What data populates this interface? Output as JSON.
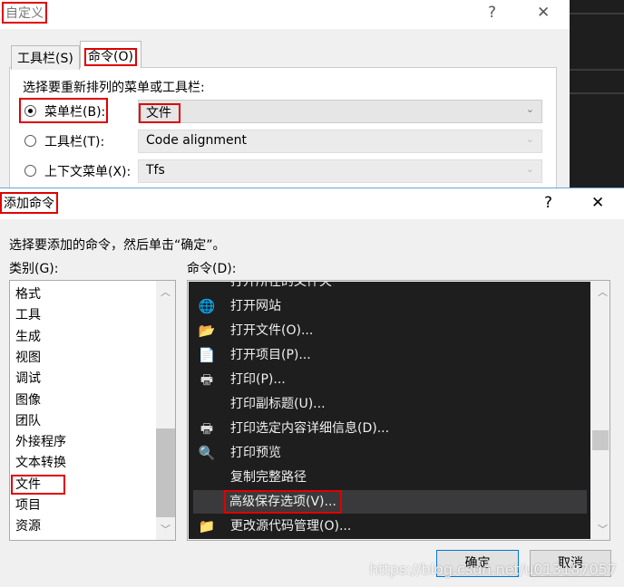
{
  "customize": {
    "title": "自定义",
    "help": "?",
    "close": "✕",
    "tabs": [
      {
        "label": "工具栏(S)"
      },
      {
        "label": "命令(O)"
      }
    ],
    "prompt": "选择要重新排列的菜单或工具栏:",
    "options": [
      {
        "label": "菜单栏(B):",
        "value": "文件",
        "selected": true
      },
      {
        "label": "工具栏(T):",
        "value": "Code alignment",
        "selected": false
      },
      {
        "label": "上下文菜单(X):",
        "value": "Tfs",
        "selected": false
      }
    ]
  },
  "add_command": {
    "title": "添加命令",
    "help": "?",
    "close": "✕",
    "instruction": "选择要添加的命令，然后单击“确定”。",
    "category_label": "类别(G):",
    "command_label": "命令(D):",
    "categories": [
      "格式",
      "工具",
      "生成",
      "视图",
      "调试",
      "图像",
      "团队",
      "外接程序",
      "文本转换",
      "文件",
      "项目",
      "资源"
    ],
    "selected_category": "文件",
    "commands": [
      {
        "label": "打开所在的文件夹",
        "icon": "none"
      },
      {
        "label": "打开网站",
        "icon": "globe-icon"
      },
      {
        "label": "打开文件(O)...",
        "icon": "open-folder-icon"
      },
      {
        "label": "打开项目(P)...",
        "icon": "open-project-icon"
      },
      {
        "label": "打印(P)...",
        "icon": "printer-icon"
      },
      {
        "label": "打印副标题(U)...",
        "icon": "none"
      },
      {
        "label": "打印选定内容详细信息(D)...",
        "icon": "printer-icon"
      },
      {
        "label": "打印预览",
        "icon": "print-preview-icon"
      },
      {
        "label": "复制完整路径",
        "icon": "none"
      },
      {
        "label": "高级保存选项(V)...",
        "icon": "none"
      },
      {
        "label": "更改源代码管理(O)...",
        "icon": "source-control-icon"
      }
    ],
    "selected_command": "高级保存选项(V)...",
    "ok": "确定",
    "cancel": "取消"
  },
  "watermark": "https://blog.csdn.net/u013187057",
  "colors": {
    "highlight": "#e00000",
    "command_list_bg": "#1e1e1f",
    "selected_row": "#3a3a3c"
  }
}
